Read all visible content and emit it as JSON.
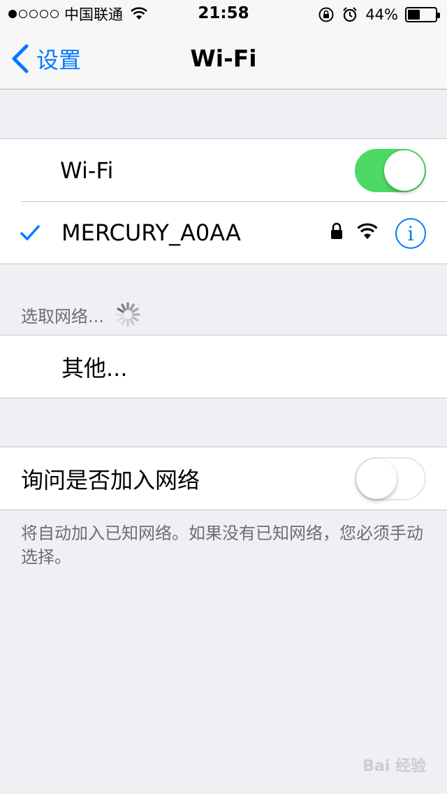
{
  "status_bar": {
    "carrier": "中国联通",
    "time": "21:58",
    "battery_percent": "44%",
    "battery_level": 0.44,
    "signal_bars_filled": 1,
    "signal_bars_total": 5,
    "icons": [
      "wifi-icon",
      "rotation-lock-icon",
      "alarm-icon",
      "battery-icon"
    ]
  },
  "nav": {
    "back_label": "设置",
    "title": "Wi-Fi"
  },
  "wifi_group": {
    "toggle_label": "Wi-Fi",
    "toggle_on": true,
    "connected_network": "MERCURY_A0AA"
  },
  "choose_network": {
    "header": "选取网络..."
  },
  "other_row": {
    "label": "其他..."
  },
  "ask_group": {
    "label": "询问是否加入网络",
    "toggle_on": false,
    "footer": "将自动加入已知网络。如果没有已知网络，您必须手动选择。"
  },
  "watermark": "Bai 经验",
  "colors": {
    "accent": "#007aff",
    "toggle_on": "#4cd964",
    "background": "#efeff4"
  }
}
